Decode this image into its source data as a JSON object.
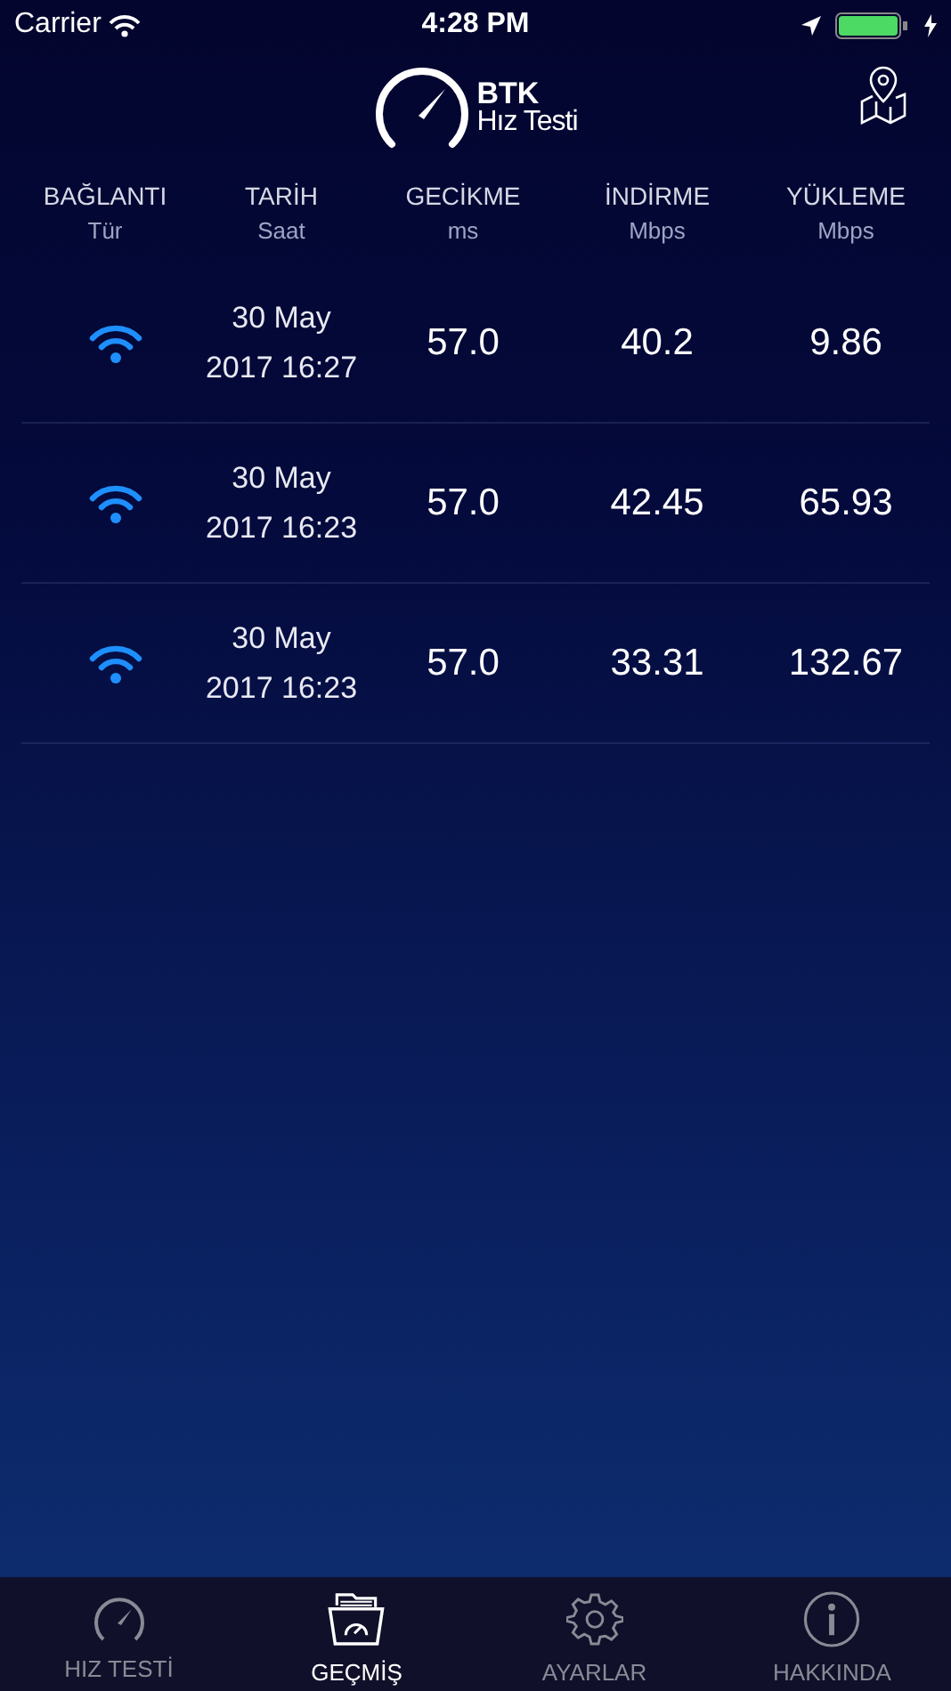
{
  "status_bar": {
    "carrier": "Carrier",
    "time": "4:28 PM"
  },
  "header": {
    "logo_title": "BTK",
    "logo_subtitle": "Hız Testi"
  },
  "columns": [
    {
      "title": "BAĞLANTI",
      "unit": "Tür"
    },
    {
      "title": "TARİH",
      "unit": "Saat"
    },
    {
      "title": "GECİKME",
      "unit": "ms"
    },
    {
      "title": "İNDİRME",
      "unit": "Mbps"
    },
    {
      "title": "YÜKLEME",
      "unit": "Mbps"
    }
  ],
  "rows": [
    {
      "kind": "wifi",
      "date": "30 May",
      "time": "2017 16:27",
      "latency": "57.0",
      "download": "40.2",
      "upload": "9.86"
    },
    {
      "kind": "wifi",
      "date": "30 May",
      "time": "2017 16:23",
      "latency": "57.0",
      "download": "42.45",
      "upload": "65.93"
    },
    {
      "kind": "wifi",
      "date": "30 May",
      "time": "2017 16:23",
      "latency": "57.0",
      "download": "33.31",
      "upload": "132.67"
    }
  ],
  "tab_bar": [
    {
      "label": "HIZ TESTİ",
      "kind": "speed",
      "selected": false
    },
    {
      "label": "GEÇMİŞ",
      "kind": "history",
      "selected": true
    },
    {
      "label": "AYARLAR",
      "kind": "settings",
      "selected": false
    },
    {
      "label": "HAKKINDA",
      "kind": "about",
      "selected": false
    }
  ]
}
